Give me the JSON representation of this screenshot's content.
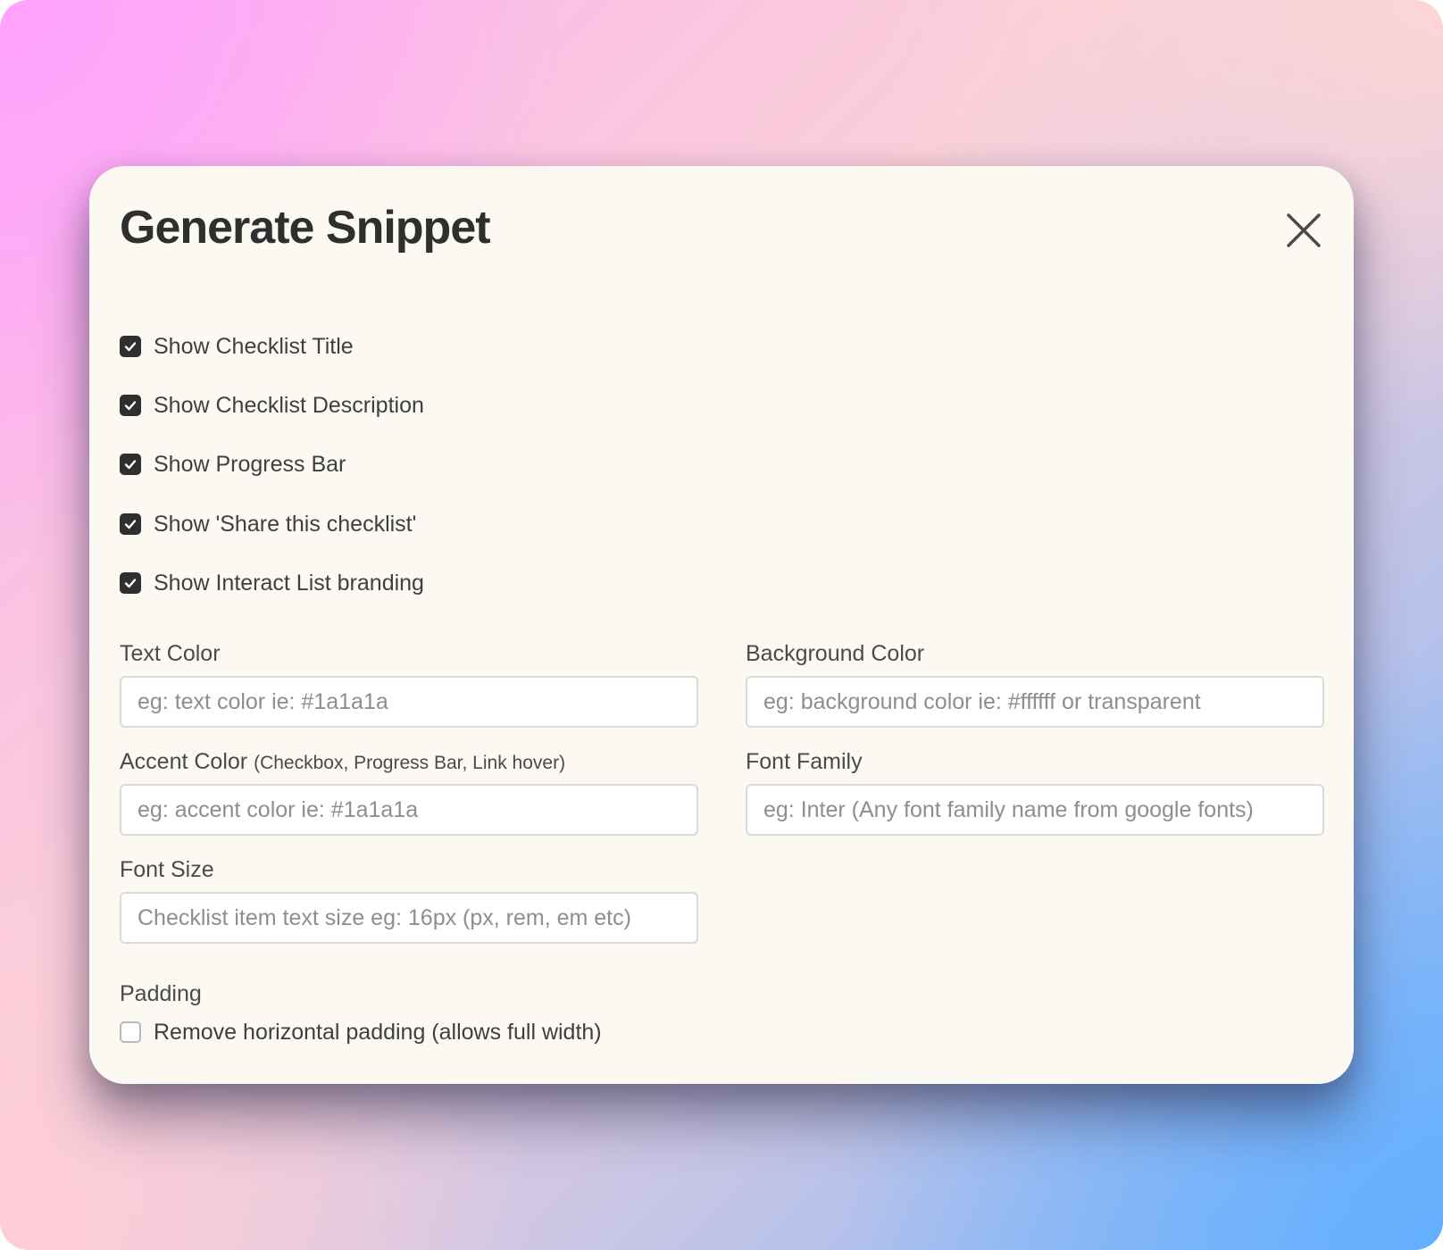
{
  "modal": {
    "title": "Generate Snippet"
  },
  "checklist_options": [
    {
      "label": "Show Checklist Title",
      "checked": true
    },
    {
      "label": "Show Checklist Description",
      "checked": true
    },
    {
      "label": "Show Progress Bar",
      "checked": true
    },
    {
      "label": "Show 'Share this checklist'",
      "checked": true
    },
    {
      "label": "Show Interact List branding",
      "checked": true
    }
  ],
  "fields": {
    "text_color": {
      "label": "Text Color",
      "placeholder": "eg: text color ie: #1a1a1a",
      "value": ""
    },
    "background_color": {
      "label": "Background Color",
      "placeholder": "eg: background color ie: #ffffff or transparent",
      "value": ""
    },
    "accent_color": {
      "label": "Accent Color",
      "hint": "(Checkbox, Progress Bar, Link hover)",
      "placeholder": "eg: accent color ie: #1a1a1a",
      "value": ""
    },
    "font_family": {
      "label": "Font Family",
      "placeholder": "eg: Inter (Any font family name from google fonts)",
      "value": ""
    },
    "font_size": {
      "label": "Font Size",
      "placeholder": "Checklist item text size eg: 16px (px, rem, em etc)",
      "value": ""
    }
  },
  "padding": {
    "label": "Padding",
    "option_label": "Remove horizontal padding (allows full width)",
    "checked": false
  },
  "colors": {
    "modal_background": "#fcf9f2",
    "checkbox_checked": "#2f2f2f",
    "text_primary": "#2f2f2f"
  },
  "icons": {
    "close": "close-icon",
    "check": "checkmark-icon"
  }
}
